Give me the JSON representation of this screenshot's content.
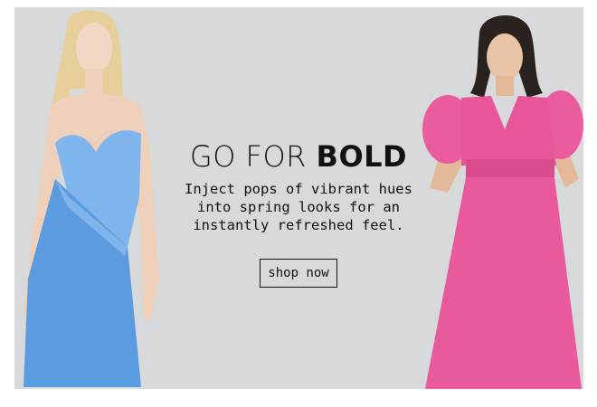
{
  "banner": {
    "headline_light": "GO FOR ",
    "headline_bold": "BOLD",
    "subcopy_line1": "Inject pops of vibrant hues",
    "subcopy_line2": "into spring looks for an",
    "subcopy_line3": "instantly refreshed feel.",
    "cta_label": "shop now"
  },
  "colors": {
    "background": "#d7d9da",
    "blue_dress": "#5b9be0",
    "pink_dress": "#e85a9b",
    "text": "#111111"
  }
}
